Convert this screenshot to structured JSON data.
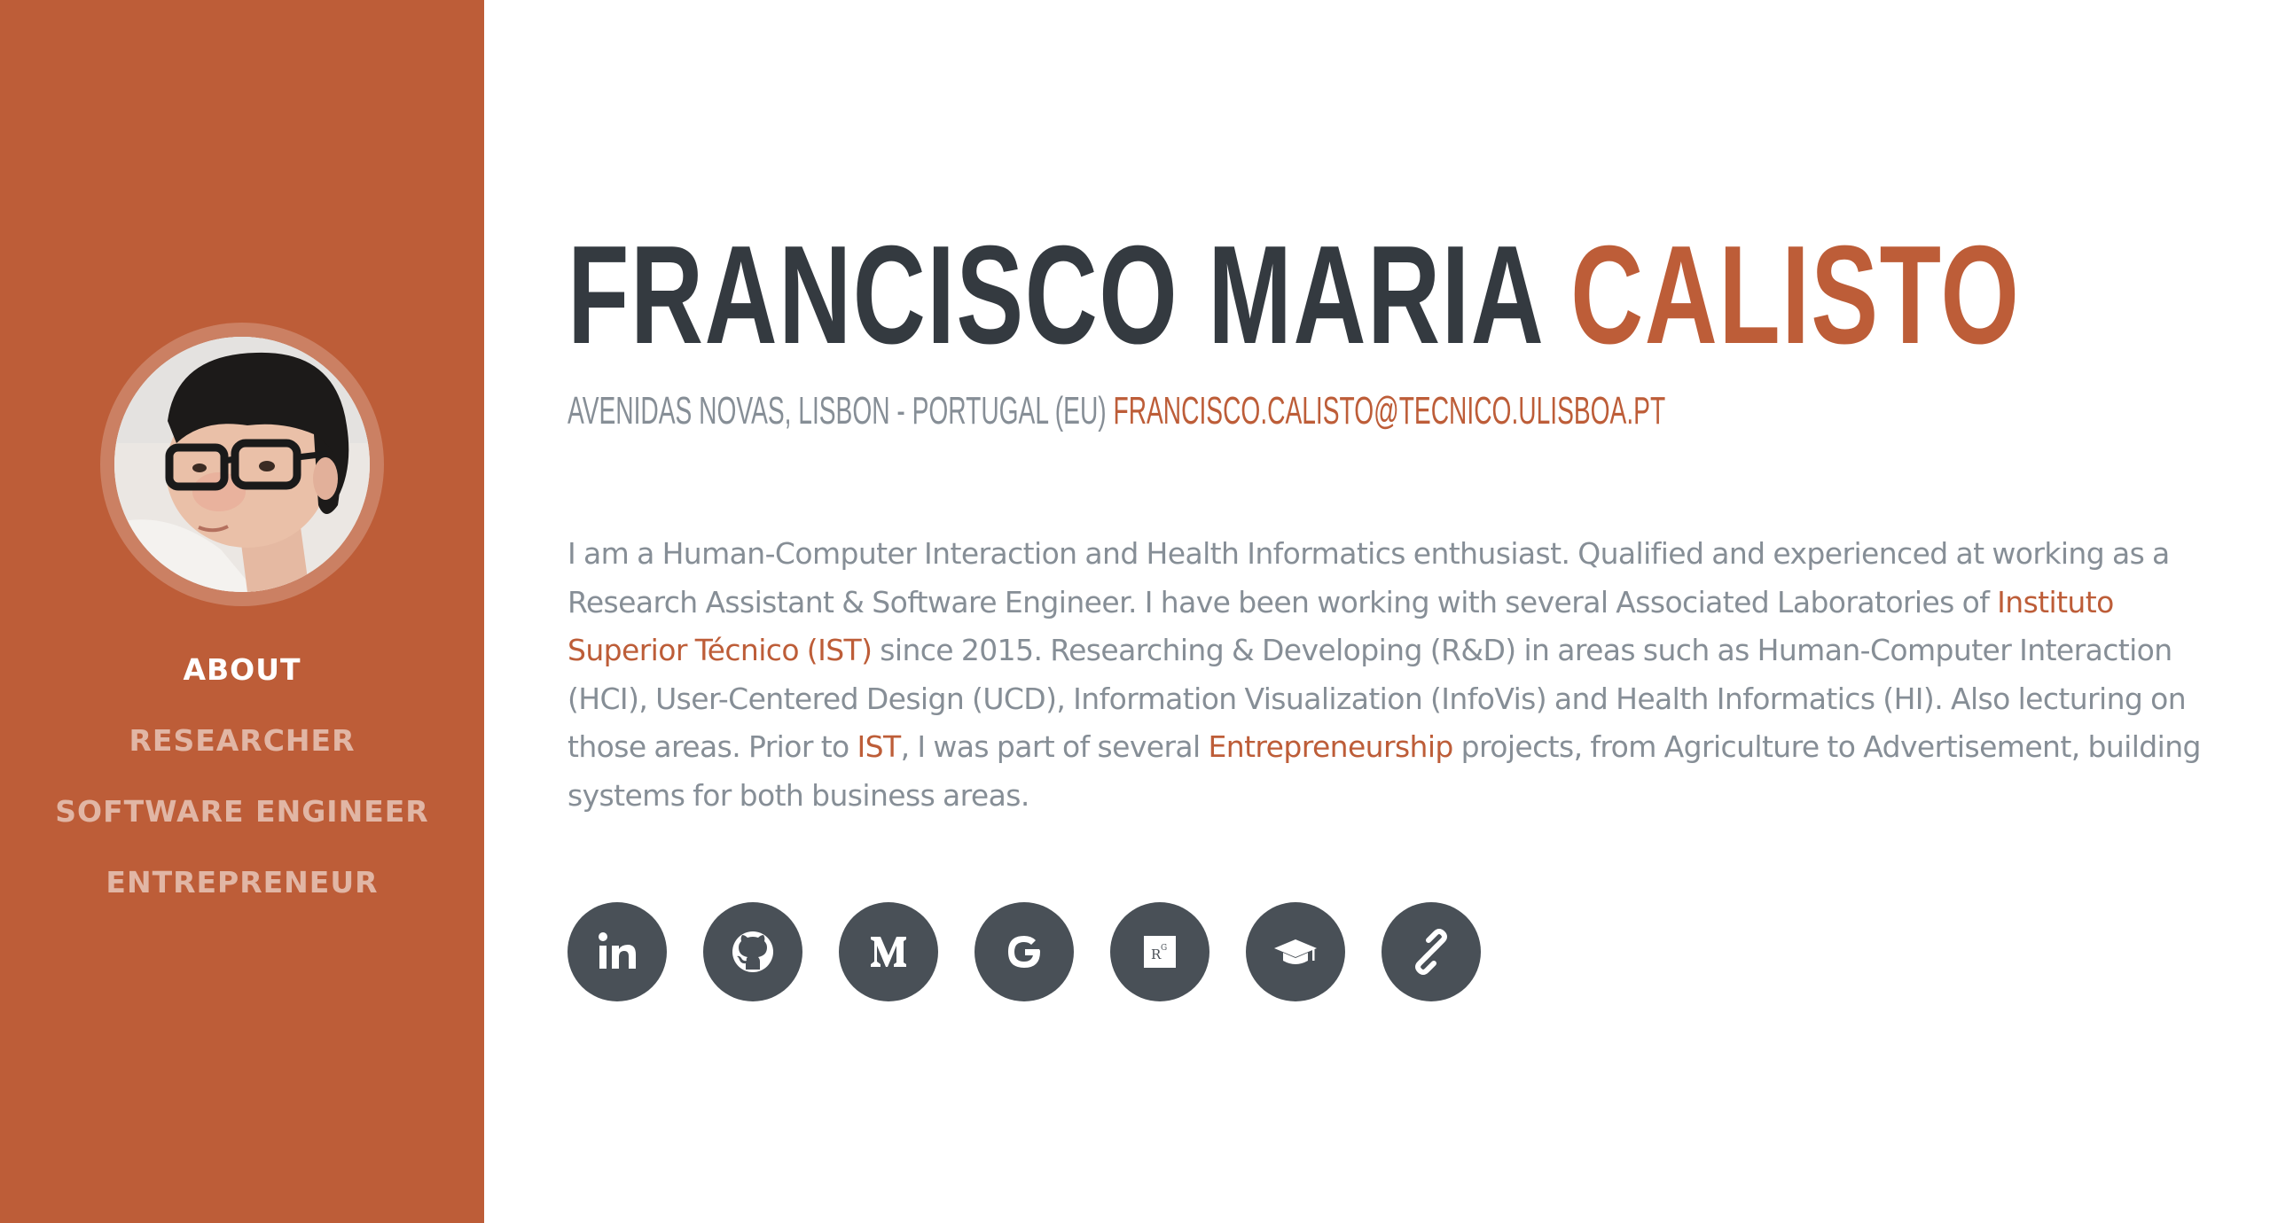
{
  "sidebar": {
    "avatar_alt": "profile photo",
    "nav": [
      {
        "label": "ABOUT",
        "active": true
      },
      {
        "label": "RESEARCHER",
        "active": false
      },
      {
        "label": "SOFTWARE ENGINEER",
        "active": false
      },
      {
        "label": "ENTREPRENEUR",
        "active": false
      }
    ]
  },
  "header": {
    "first_name": "FRANCISCO MARIA",
    "last_name": "CALISTO",
    "address": "AVENIDAS NOVAS, LISBON - PORTUGAL (EU)",
    "email": "FRANCISCO.CALISTO@TECNICO.ULISBOA.PT"
  },
  "bio": {
    "p1": "I am a Human-Computer Interaction and Health Informatics enthusiast. Qualified and experienced at working as a Research Assistant & Software Engineer. I have been working with several Associated Laboratories of ",
    "link_ist_full": "Instituto Superior Técnico (IST)",
    "p2": " since 2015. Researching & Developing (R&D) in areas such as Human-Computer Interaction (HCI), User-Centered Design (UCD), Information Visualization (InfoVis) and Health Informatics (HI). Also lecturing on those areas. Prior to ",
    "link_ist": "IST",
    "p3": ", I was part of several ",
    "link_entrepreneurship": "Entrepreneurship",
    "p4": " projects, from Agriculture to Advertisement, building systems for both business areas."
  },
  "social": [
    {
      "icon": "linkedin-icon"
    },
    {
      "icon": "github-icon"
    },
    {
      "icon": "medium-icon"
    },
    {
      "icon": "google-icon"
    },
    {
      "icon": "researchgate-icon"
    },
    {
      "icon": "graduation-cap-icon"
    },
    {
      "icon": "link-icon"
    }
  ],
  "colors": {
    "primary": "#bd5d38",
    "heading": "#343a40",
    "muted": "#868e96",
    "social_bg": "#495057"
  }
}
